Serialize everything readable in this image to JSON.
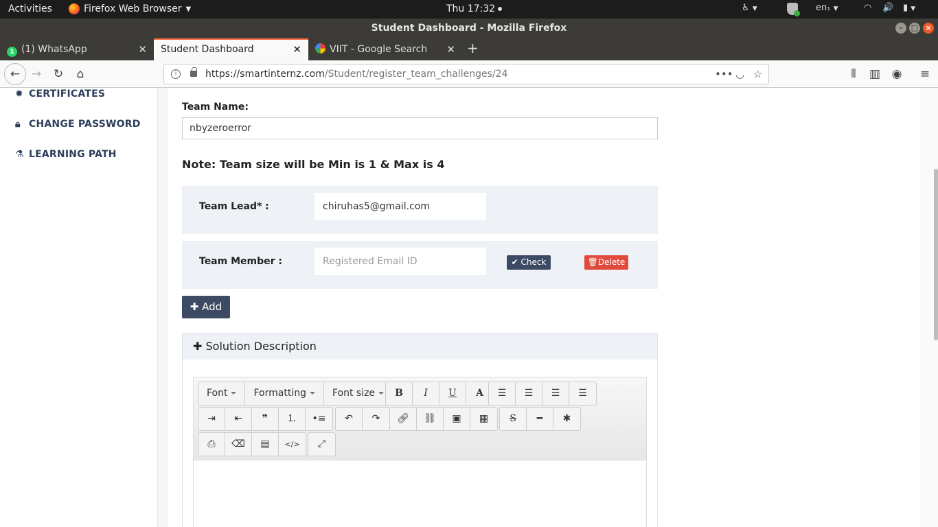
{
  "topbar": {
    "activities": "Activities",
    "app_name": "Firefox Web Browser",
    "clock": "Thu 17:32",
    "lang": "en₁"
  },
  "window": {
    "title": "Student Dashboard - Mozilla Firefox"
  },
  "tabs": [
    {
      "label": "(1) WhatsApp",
      "badge": "1"
    },
    {
      "label": "Student Dashboard"
    },
    {
      "label": "VIIT - Google Search"
    }
  ],
  "url": {
    "host": "https://smartinternz.com",
    "path": "/Student/register_team_challenges/24"
  },
  "sidebar": {
    "items": [
      {
        "label": "CERTIFICATES"
      },
      {
        "label": "CHANGE PASSWORD"
      },
      {
        "label": "LEARNING PATH"
      }
    ]
  },
  "form": {
    "team_name_label": "Team Name:",
    "team_name_value": "nbyzeroerror",
    "note": "Note: Team size will be Min is 1 & Max is 4",
    "team_lead_label": "Team Lead* :",
    "team_lead_value": "chiruhas5@gmail.com",
    "team_member_label": "Team Member :",
    "team_member_placeholder": "Registered Email ID",
    "check_label": "Check",
    "delete_label": "Delete",
    "add_label": "Add",
    "solution_title": "Solution Description"
  },
  "editor": {
    "font": "Font",
    "formatting": "Formatting",
    "font_size": "Font size",
    "bold": "B",
    "italic": "I",
    "underline": "U",
    "color": "A"
  }
}
